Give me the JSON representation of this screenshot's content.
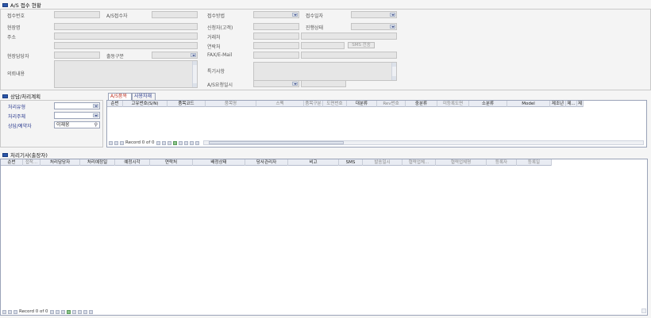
{
  "as_reception": {
    "title": "A/S 접수 현황",
    "labels": {
      "reception_no": "접수번호",
      "as_receiver": "A/S접수자",
      "reception_method": "접수방법",
      "reception_date": "접수일자",
      "site": "현장명",
      "applicant": "신청자(고객)",
      "progress": "진행상태",
      "address": "주소",
      "reserved": "거래처",
      "contact": "연락처",
      "site_manager": "현장담당자",
      "dispatch_type": "출동구분",
      "fax_email": "FAX/E-Mail",
      "request": "의뢰내용",
      "special": "특기사항",
      "complete_date": "A/S요청일시"
    },
    "sms_button": "SMS 전송"
  },
  "consult": {
    "title": "상담/처리계획",
    "labels": {
      "type": "처리유형",
      "owner": "처리주체",
      "consultant": "상담/예약자"
    },
    "consultant_value": "이재웅"
  },
  "tabs": [
    {
      "label": "A/S품목",
      "active": true
    },
    {
      "label": "사용자재",
      "active": false
    }
  ],
  "items_grid": {
    "columns": [
      {
        "label": "순번",
        "dim": false,
        "w": 20
      },
      {
        "label": "고유번호(S/N)",
        "dim": false,
        "w": 56
      },
      {
        "label": "품목코드",
        "dim": false,
        "w": 48
      },
      {
        "label": "품목명",
        "dim": true,
        "w": 64
      },
      {
        "label": "스펙",
        "dim": true,
        "w": 60
      },
      {
        "label": "품목구분",
        "dim": true,
        "w": 24
      },
      {
        "label": "도면번호",
        "dim": true,
        "w": 30
      },
      {
        "label": "대분류",
        "dim": false,
        "w": 38
      },
      {
        "label": "Rev번호",
        "dim": true,
        "w": 36
      },
      {
        "label": "중분류",
        "dim": false,
        "w": 40
      },
      {
        "label": "미등록도면",
        "dim": true,
        "w": 40
      },
      {
        "label": "소분류",
        "dim": false,
        "w": 48
      },
      {
        "label": "Model",
        "dim": false,
        "w": 54
      },
      {
        "label": "제조년",
        "dim": false,
        "w": 20
      },
      {
        "label": "제...",
        "dim": false,
        "w": 14
      },
      {
        "label": "제",
        "dim": false,
        "w": 8
      }
    ],
    "record": "Record 0 of 0"
  },
  "history": {
    "title": "처리기사(출장자)",
    "columns": [
      {
        "label": "순번",
        "dim": false,
        "w": 28
      },
      {
        "label": "접착...",
        "dim": true,
        "w": 22
      },
      {
        "label": "처리담당자",
        "dim": false,
        "w": 50
      },
      {
        "label": "처리예정일",
        "dim": false,
        "w": 44
      },
      {
        "label": "예정시각",
        "dim": false,
        "w": 44
      },
      {
        "label": "연락처",
        "dim": false,
        "w": 54
      },
      {
        "label": "배정상태",
        "dim": false,
        "w": 66
      },
      {
        "label": "당사관리자",
        "dim": false,
        "w": 54
      },
      {
        "label": "비고",
        "dim": false,
        "w": 64
      },
      {
        "label": "SMS",
        "dim": false,
        "w": 30
      },
      {
        "label": "발송일시",
        "dim": true,
        "w": 50
      },
      {
        "label": "협력업체...",
        "dim": true,
        "w": 42
      },
      {
        "label": "협력업체명",
        "dim": true,
        "w": 64
      },
      {
        "label": "등록자",
        "dim": true,
        "w": 38
      },
      {
        "label": "등록일",
        "dim": true,
        "w": 44
      }
    ],
    "record": "Record 0 of 0"
  },
  "colors": {
    "accent": "#2c56a8",
    "active_tab": "#c0392b"
  }
}
